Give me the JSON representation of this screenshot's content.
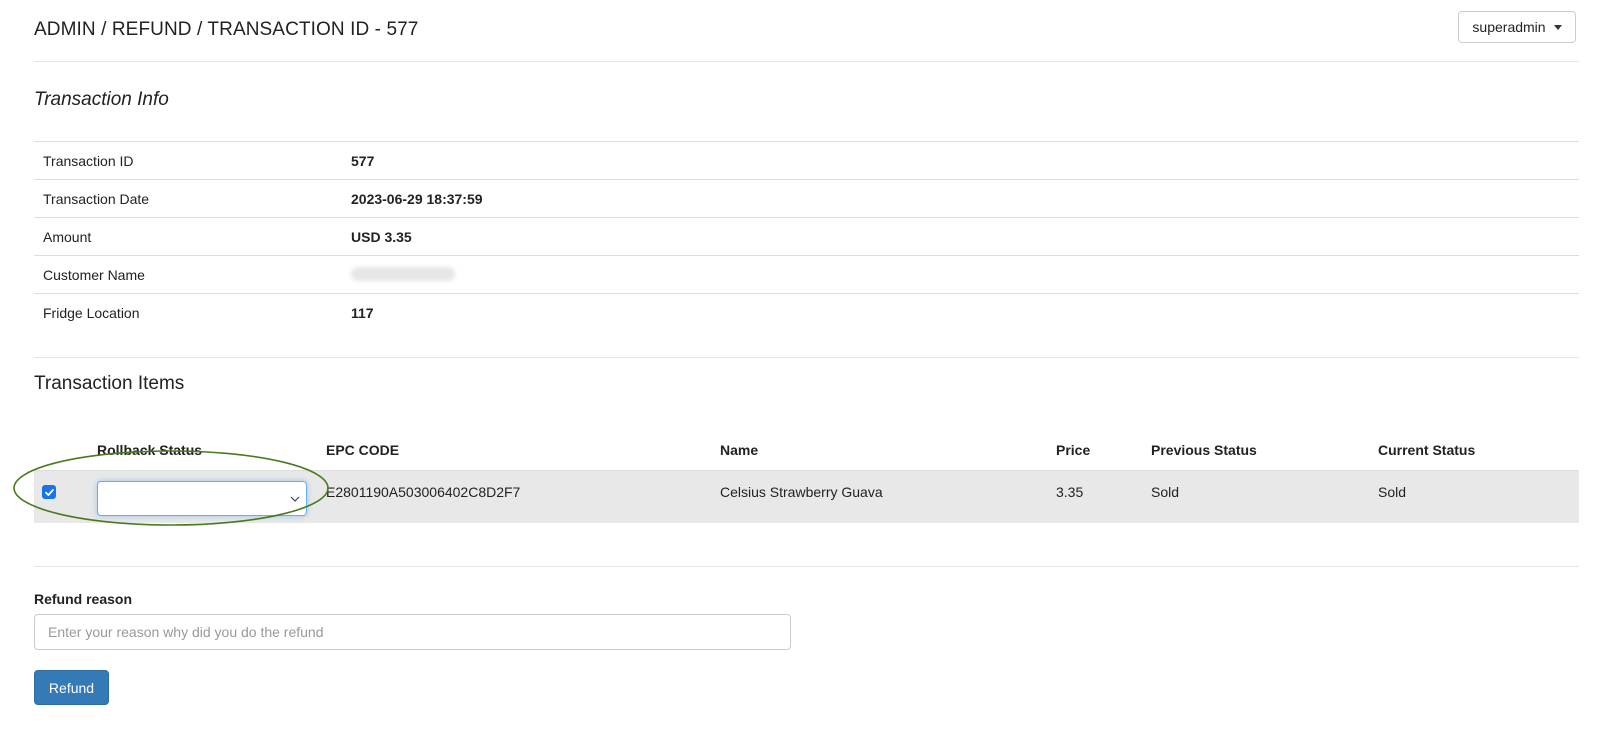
{
  "header": {
    "breadcrumb_title": "ADMIN / REFUND / TRANSACTION ID - 577",
    "user_menu_label": "superadmin"
  },
  "transaction_info": {
    "title": "Transaction Info",
    "rows": [
      {
        "label": "Transaction ID",
        "value": "577"
      },
      {
        "label": "Transaction Date",
        "value": "2023-06-29 18:37:59"
      },
      {
        "label": "Amount",
        "value": "USD 3.35"
      },
      {
        "label": "Customer Name",
        "value": ""
      },
      {
        "label": "Fridge Location",
        "value": "117"
      }
    ]
  },
  "transaction_items": {
    "title": "Transaction Items",
    "columns": [
      "Rollback Status",
      "EPC CODE",
      "Name",
      "Price",
      "Previous Status",
      "Current Status"
    ],
    "rows": [
      {
        "checked": true,
        "rollback_status": "",
        "epc_code": "E2801190A503006402C8D2F7",
        "name": "Celsius Strawberry Guava",
        "price": "3.35",
        "previous_status": "Sold",
        "current_status": "Sold"
      }
    ]
  },
  "refund": {
    "label": "Refund reason",
    "placeholder": "Enter your reason why did you do the refund",
    "value": "",
    "button_label": "Refund"
  },
  "colors": {
    "primary_button": "#337ab7",
    "row_highlight": "#e8e8e8",
    "annotation_ellipse": "#4a7a1e",
    "checkbox": "#1a73e8"
  },
  "icons": {
    "user_menu_caret": "caret-down-icon",
    "select_chevron": "chevron-down-icon",
    "checkbox_check": "check-icon"
  }
}
